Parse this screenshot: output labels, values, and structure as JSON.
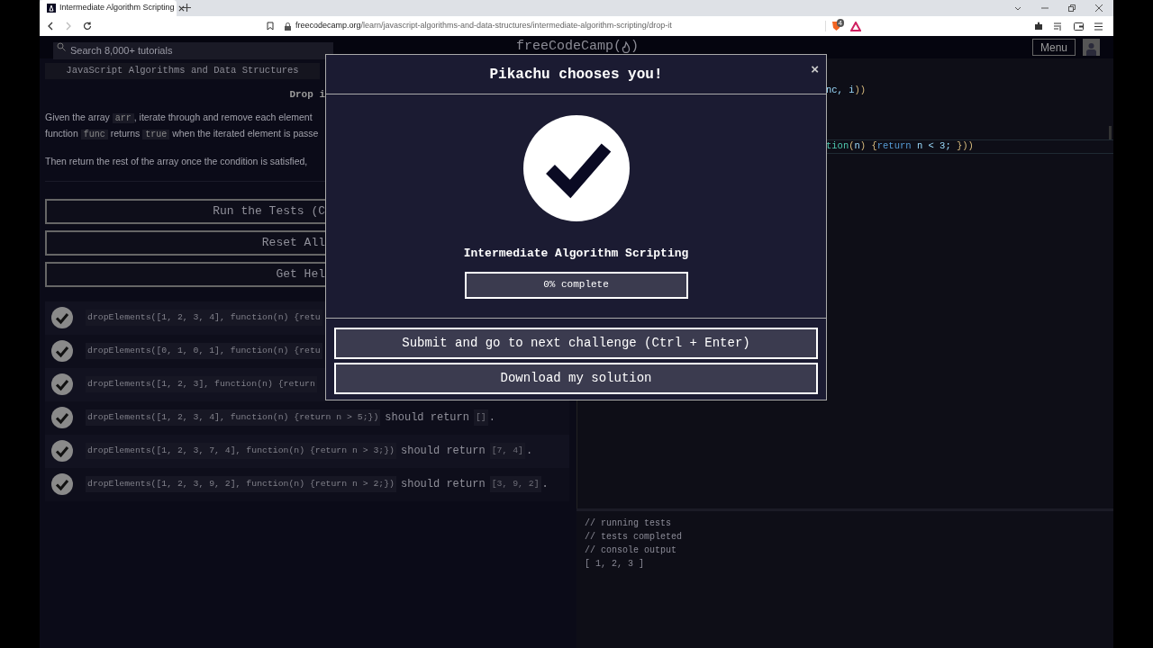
{
  "browser": {
    "tab": {
      "title": "Intermediate Algorithm Scripting",
      "selected": true
    },
    "url_host": "freecodecamp.org",
    "url_path": "/learn/javascript-algorithms-and-data-structures/intermediate-algorithm-scripting/drop-it",
    "shield_badge": "4"
  },
  "header": {
    "search": {
      "placeholder": "Search 8,000+ tutorials"
    },
    "logo_before": "freeCodeCamp(",
    "logo_after": ")",
    "menu": "Menu"
  },
  "lesson": {
    "breadcrumb": "JavaScript Algorithms and Data Structures",
    "title": "Drop i",
    "paragraphs": [
      [
        [
          {
            "text": "Given the array "
          },
          {
            "code": "arr"
          },
          {
            "text": ", iterate through and remove each element"
          }
        ],
        [
          {
            "text": "function "
          },
          {
            "code": "func"
          },
          {
            "text": " returns "
          },
          {
            "code": "true"
          },
          {
            "text": " when the iterated element is passe"
          }
        ]
      ],
      [
        [
          {
            "text": "Then return the rest of the array once the condition is satisfied,"
          }
        ]
      ]
    ],
    "buttons": [
      "Run the Tests (C",
      "Reset All",
      "Get Hel"
    ],
    "tests": [
      {
        "passed": true,
        "code": "dropElements([1, 2, 3, 4], function(n) {retu"
      },
      {
        "passed": true,
        "code": "dropElements([0, 1, 0, 1], function(n) {retu"
      },
      {
        "passed": true,
        "code": "dropElements([1, 2, 3], function(n) {return"
      },
      {
        "passed": true,
        "code": "dropElements([1, 2, 3, 4], function(n) {return n > 5;})",
        "text": "should return",
        "result": "[]",
        "end": "."
      },
      {
        "passed": true,
        "code": "dropElements([1, 2, 3, 7, 4], function(n) {return n > 3;})",
        "text": "should return",
        "result": "[7, 4]",
        "end": "."
      },
      {
        "passed": true,
        "code": "dropElements([1, 2, 3, 9, 2], function(n) {return n > 2;})",
        "text": "should return",
        "result": "[3, 9, 2]",
        "end": "."
      }
    ]
  },
  "editor": {
    "lines": [
      {
        "tokens": [
          {
            "t": "nc, i",
            "kind": "name"
          },
          {
            "t": "))",
            "kind": "bracket"
          }
        ]
      },
      {
        "tokens": [
          {
            "t": "tion",
            "kind": "function"
          },
          {
            "t": "(",
            "kind": "bracket"
          },
          {
            "t": "n",
            "kind": "name"
          },
          {
            "t": ") ",
            "kind": "bracket"
          },
          {
            "t": "{",
            "kind": "bracket"
          },
          {
            "t": "return",
            "kind": "keyword"
          },
          {
            "t": " n < 3; ",
            "kind": "name"
          },
          {
            "t": "})",
            "kind": "bracket"
          },
          {
            "t": ")",
            "kind": "bracket"
          }
        ],
        "highlighted": true
      }
    ]
  },
  "console": [
    "// running tests",
    "// tests completed",
    "// console output",
    "[ 1, 2, 3 ]"
  ],
  "modal": {
    "title": "Pikachu chooses you!",
    "close": "×",
    "block": "Intermediate Algorithm Scripting",
    "progress": {
      "level": 0,
      "label": "0% complete"
    },
    "buttons": [
      "Submit and go to next challenge (Ctrl + Enter)",
      "Download my solution"
    ]
  }
}
